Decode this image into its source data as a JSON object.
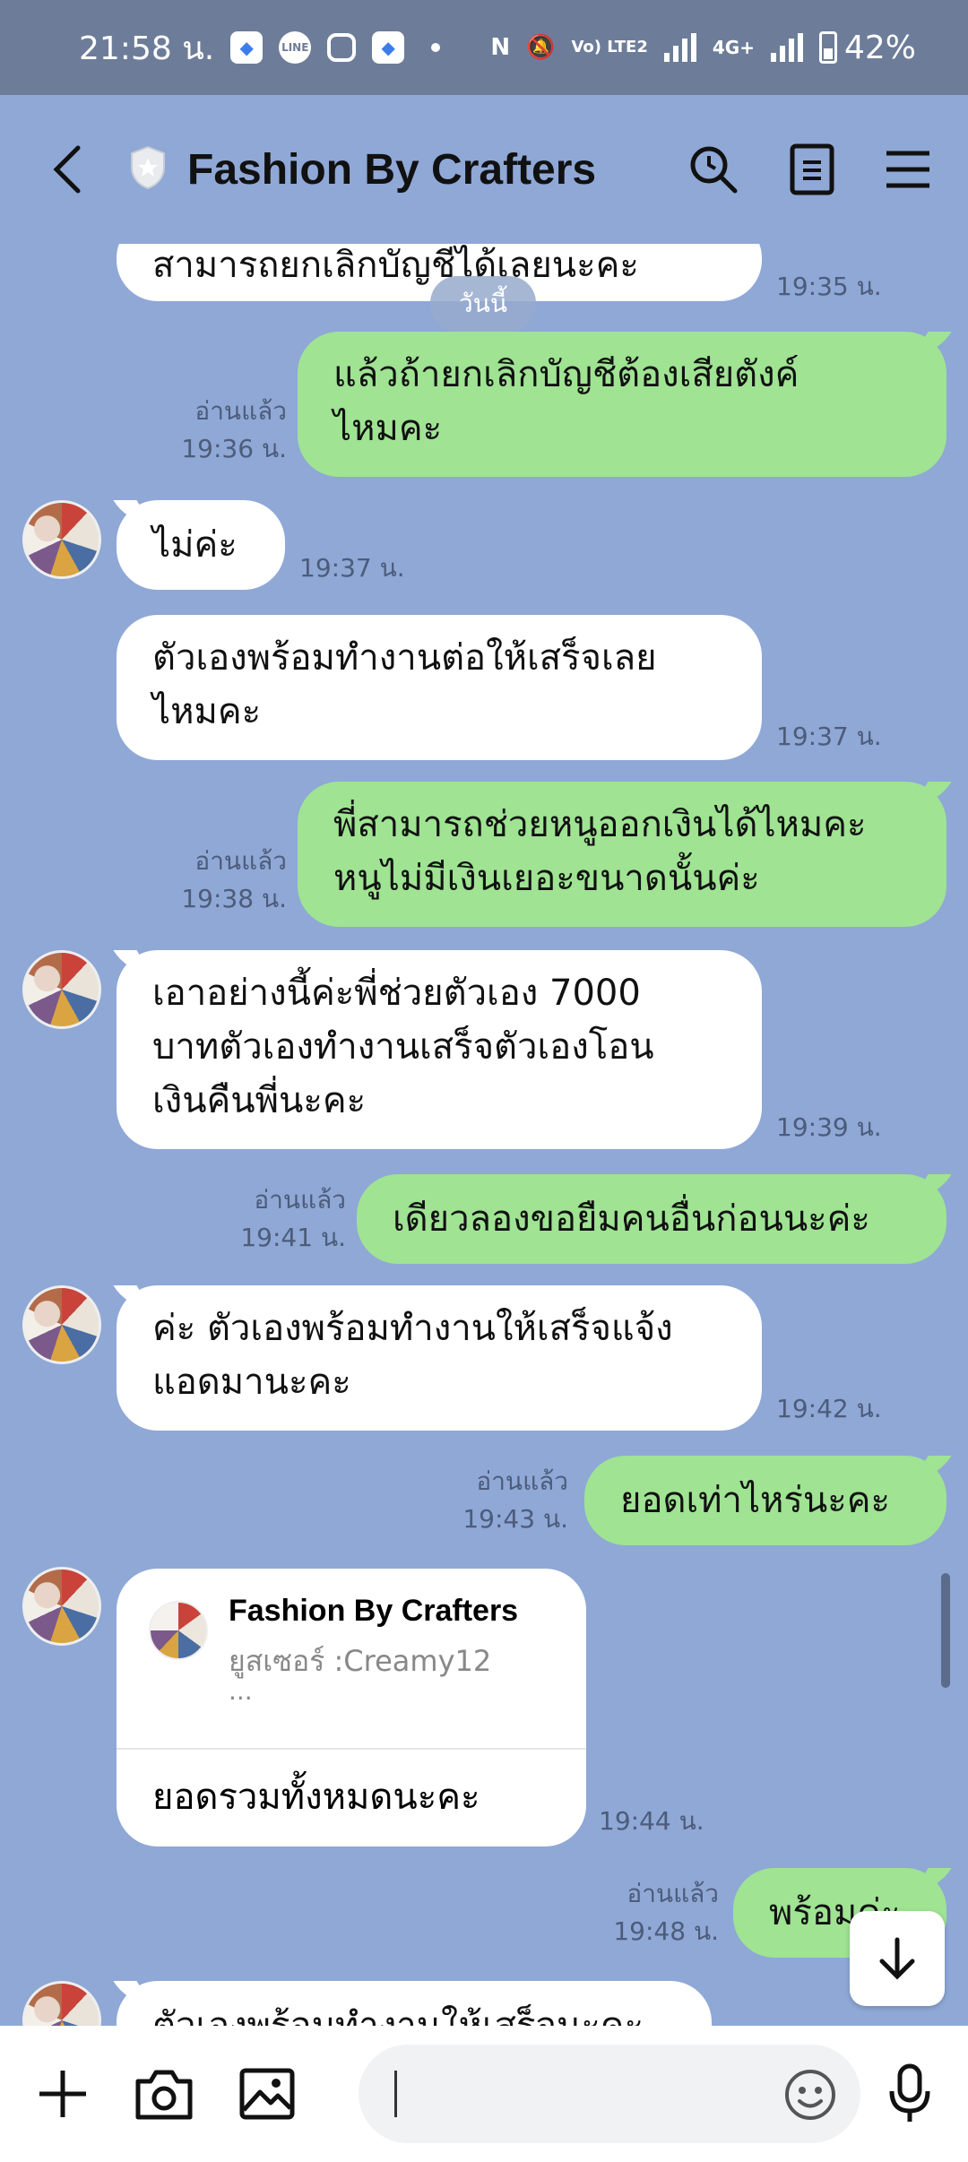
{
  "status_bar": {
    "time": "21:58 น.",
    "battery": "42%",
    "network": "4G+",
    "volte": "Vo) LTE2"
  },
  "header": {
    "title": "Fashion By Crafters"
  },
  "chat": {
    "date_chip": "วันนี้",
    "read_label": "อ่านแล้ว",
    "messages": [
      {
        "dir": "in",
        "text": "สามารถยกเลิกบัญชีได้เลยนะคะ",
        "time": "19:35 น."
      },
      {
        "dir": "out",
        "text": "แล้วถ้ายกเลิกบัญชีต้องเสียตังค์ไหมคะ",
        "line1": "แล้วถ้ายกเลิกบัญชีต้องเสียตังค์",
        "line2": "ไหมคะ",
        "time": "19:36 น."
      },
      {
        "dir": "in",
        "text": "ไม่ค่ะ",
        "time": "19:37 น."
      },
      {
        "dir": "in",
        "line1": "ตัวเองพร้อมทำงานต่อให้เสร็จเลย",
        "line2": "ไหมคะ",
        "time": "19:37 น."
      },
      {
        "dir": "out",
        "line1": "พี่สามารถช่วยหนูออกเงินได้ไหมคะ",
        "line2": "หนูไม่มีเงินเยอะขนาดนั้นค่ะ",
        "time": "19:38 น."
      },
      {
        "dir": "in",
        "line1": "เอาอย่างนี้ค่ะพี่ช่วยตัวเอง 7000",
        "line2": "บาทตัวเองทำงานเสร็จตัวเองโอน",
        "line3": "เงินคืนพี่นะคะ",
        "time": "19:39 น."
      },
      {
        "dir": "out",
        "text": "เดียวลองขอยืมคนอื่นก่อนนะค่ะ",
        "time": "19:41 น."
      },
      {
        "dir": "in",
        "line1": "ค่ะ ตัวเองพร้อมทำงานให้เสร็จแจ้ง",
        "line2": "แอดมานะคะ",
        "time": "19:42 น."
      },
      {
        "dir": "out",
        "text": "ยอดเท่าไหร่นะคะ",
        "time": "19:43 น."
      },
      {
        "dir": "out",
        "text": "พร้อมค่ะ",
        "time": "19:48 น."
      },
      {
        "dir": "in",
        "text": "ตัวเองพร้อมทำงานให้เสร็จนะคะ"
      }
    ],
    "card": {
      "name": "Fashion By Crafters",
      "user": "ยูสเซอร์ :Creamy12",
      "ellipsis": "...",
      "text": "ยอดรวมทั้งหมดนะคะ",
      "time": "19:44 น."
    }
  },
  "composer": {
    "placeholder": ""
  },
  "colors": {
    "chat_background": "#8fa8d6",
    "outgoing_bubble": "#9fe393",
    "incoming_bubble": "#ffffff",
    "status_bar": "#6d7d99"
  }
}
